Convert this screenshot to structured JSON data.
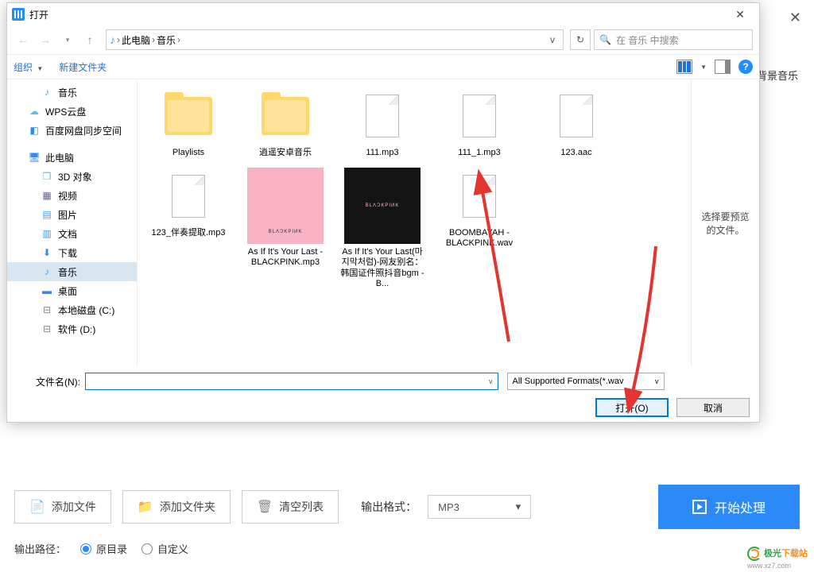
{
  "dialog": {
    "title": "打开",
    "close": "✕",
    "nav": {
      "path_root": "此电脑",
      "path_current": "音乐",
      "search_placeholder": "在 音乐 中搜索"
    },
    "toolbar": {
      "organize": "组织",
      "new_folder": "新建文件夹"
    },
    "sidebar": [
      {
        "icon": "♪",
        "label": "音乐",
        "color": "#41a5ee",
        "indent": 2
      },
      {
        "icon": "☁",
        "label": "WPS云盘",
        "color": "#52c3f1",
        "indent": 1
      },
      {
        "icon": "◧",
        "label": "百度网盘同步空间",
        "color": "#2b8af7",
        "indent": 1
      },
      {
        "icon": "🖥",
        "label": "此电脑",
        "color": "#2b8af7",
        "indent": 1,
        "spacer": true
      },
      {
        "icon": "❒",
        "label": "3D 对象",
        "color": "#4fc3d9",
        "indent": 2
      },
      {
        "icon": "▦",
        "label": "视频",
        "color": "#6b5b95",
        "indent": 2
      },
      {
        "icon": "▤",
        "label": "图片",
        "color": "#3d9be9",
        "indent": 2
      },
      {
        "icon": "▥",
        "label": "文档",
        "color": "#3d9be9",
        "indent": 2
      },
      {
        "icon": "⬇",
        "label": "下载",
        "color": "#2b8af7",
        "indent": 2
      },
      {
        "icon": "♪",
        "label": "音乐",
        "color": "#41a5ee",
        "indent": 2,
        "selected": true
      },
      {
        "icon": "▬",
        "label": "桌面",
        "color": "#2b8af7",
        "indent": 2
      },
      {
        "icon": "⊟",
        "label": "本地磁盘 (C:)",
        "color": "#888",
        "indent": 2
      },
      {
        "icon": "⊟",
        "label": "软件 (D:)",
        "color": "#888",
        "indent": 2
      }
    ],
    "files": [
      {
        "type": "folder",
        "name": "Playlists"
      },
      {
        "type": "folder",
        "name": "逍遥安卓音乐"
      },
      {
        "type": "file",
        "name": "111.mp3"
      },
      {
        "type": "file",
        "name": "111_1.mp3"
      },
      {
        "type": "file",
        "name": "123.aac"
      },
      {
        "type": "file",
        "name": "123_伴奏提取.mp3"
      },
      {
        "type": "pink",
        "name": "As If It's Your Last - BLACKPINK.mp3",
        "cover": "BLΛƆKPIИK"
      },
      {
        "type": "black",
        "name": "As If It's Your Last(마지막처럼)-网友别名：韩国证件照抖音bgm - B...",
        "cover": "BLΛƆKPIИK"
      },
      {
        "type": "file",
        "name": "BOOMBAYAH - BLACKPINK.wav"
      }
    ],
    "preview_text": "选择要预览的文件。",
    "filename_label": "文件名(N):",
    "filename_value": "",
    "filter": "All Supported Formats(*.wav",
    "open_btn": "打开(O)",
    "cancel_btn": "取消"
  },
  "app": {
    "bg_close": "✕",
    "bg_music_label": "背景音乐",
    "add_file": "添加文件",
    "add_folder": "添加文件夹",
    "clear_list": "清空列表",
    "output_format_label": "输出格式：",
    "output_format_value": "MP3",
    "start_process": "开始处理",
    "output_path_label": "输出路径：",
    "radio_original": "原目录",
    "radio_custom": "自定义"
  },
  "watermark": {
    "brand1": "极光",
    "brand2": "下载站",
    "url": "www.xz7.com"
  }
}
